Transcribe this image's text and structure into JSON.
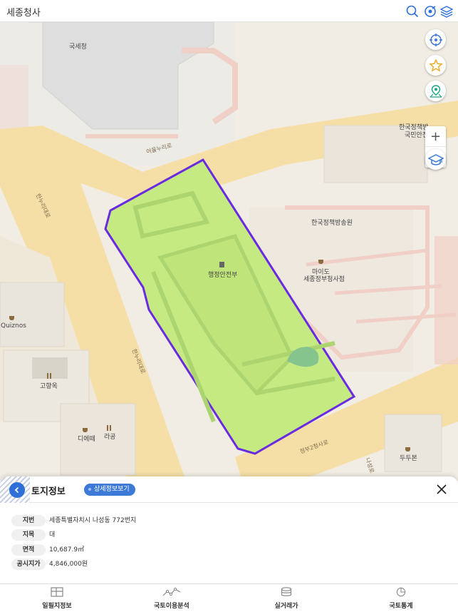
{
  "header": {
    "title": "세종청사",
    "icons": [
      "search-icon",
      "target-icon",
      "layers-icon"
    ]
  },
  "map": {
    "labels": {
      "tax_office": "국세청",
      "nat_policy_broadcast_top_1": "한국정책방",
      "nat_policy_broadcast_top_2": "국민안전",
      "nat_policy_broadcast": "한국정책방송원",
      "ministry": "행정안전부",
      "myo_do_1": "마이도",
      "myo_do_2": "세종정부청사점",
      "quiznos": "Quiznos",
      "gohyang": "고향옥",
      "diyemme": "디에떼",
      "ragong": "라공",
      "dudubon": "두두본",
      "road_hannuri_1": "한누리대로",
      "road_hannuri_2": "한누리대로",
      "road_eojin": "어울누리로",
      "road_jeongbu": "정부2청사로",
      "road_naseong": "나성로"
    },
    "controls": {
      "locate": "compass-icon",
      "favorite": "star-icon",
      "place": "map-pin-icon",
      "zoom_in": "+",
      "zoom_out": "−",
      "education": "graduation-cap-icon"
    },
    "parcel_color": "#6a2be0",
    "parcel_fill": "#c5ea82"
  },
  "panel": {
    "title": "토지정보",
    "detail_button": "상세정보보기",
    "rows": [
      {
        "key": "지번",
        "value": "세종특별자치시 나성동 772번지"
      },
      {
        "key": "지목",
        "value": "대"
      },
      {
        "key": "면적",
        "value": "10,687.9㎡"
      },
      {
        "key": "공시지가",
        "value": "4,846,000원"
      }
    ]
  },
  "bottom_nav": {
    "items": [
      {
        "label": "일필지정보",
        "icon": "map-grid-icon"
      },
      {
        "label": "국토이용분석",
        "icon": "line-chart-icon"
      },
      {
        "label": "실거래가",
        "icon": "coins-icon"
      },
      {
        "label": "국토통계",
        "icon": "pie-chart-icon"
      }
    ]
  }
}
